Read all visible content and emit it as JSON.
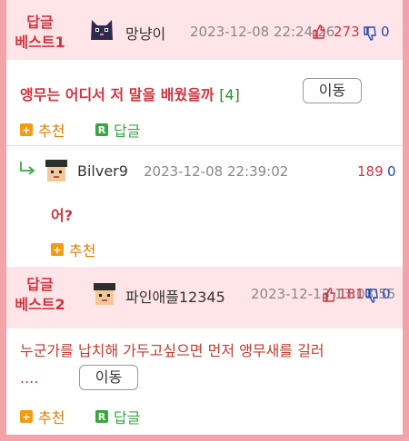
{
  "best1": {
    "label": "답글\n베스트1",
    "label_line1": "답글",
    "label_line2": "베스트1",
    "nickname": "망냥이",
    "date": "2023-12-08 22:24:26",
    "upvotes": "273",
    "downvotes": "0",
    "content": "앵무는 어디서 저 말을 배웠을까",
    "reply_count": "[4]",
    "move_label": "이동",
    "recommend_label": "추천",
    "reply_label": "답글"
  },
  "reply1": {
    "nickname": "Bilver9",
    "date": "2023-12-08 22:39:02",
    "upvotes": "189",
    "downvotes": "0",
    "content": "어?",
    "recommend_label": "추천"
  },
  "best2": {
    "label_line1": "답글",
    "label_line2": "베스트2",
    "nickname": "파인애플12345",
    "date": "2023-12-13 13:03:55",
    "upvotes": "181",
    "downvotes": "0",
    "content_line1": "누군가를 납치해 가두고싶으면 먼저 앵무새를 길러",
    "content_line2": "....",
    "move_label": "이동",
    "recommend_label": "추천",
    "reply_label": "답글"
  },
  "colors": {
    "accent_red": "#d0343f",
    "border_pink": "#f4a3a8",
    "header_bg": "#ffe5e8",
    "down_blue": "#2248b5",
    "green": "#3aa641",
    "orange": "#f39c12"
  },
  "icons": [
    "cat-avatar-icon",
    "pixel-face-avatar-icon",
    "thumbs-up-icon",
    "thumbs-down-icon",
    "reply-arrow-icon",
    "plus-badge-icon",
    "r-badge-icon"
  ]
}
